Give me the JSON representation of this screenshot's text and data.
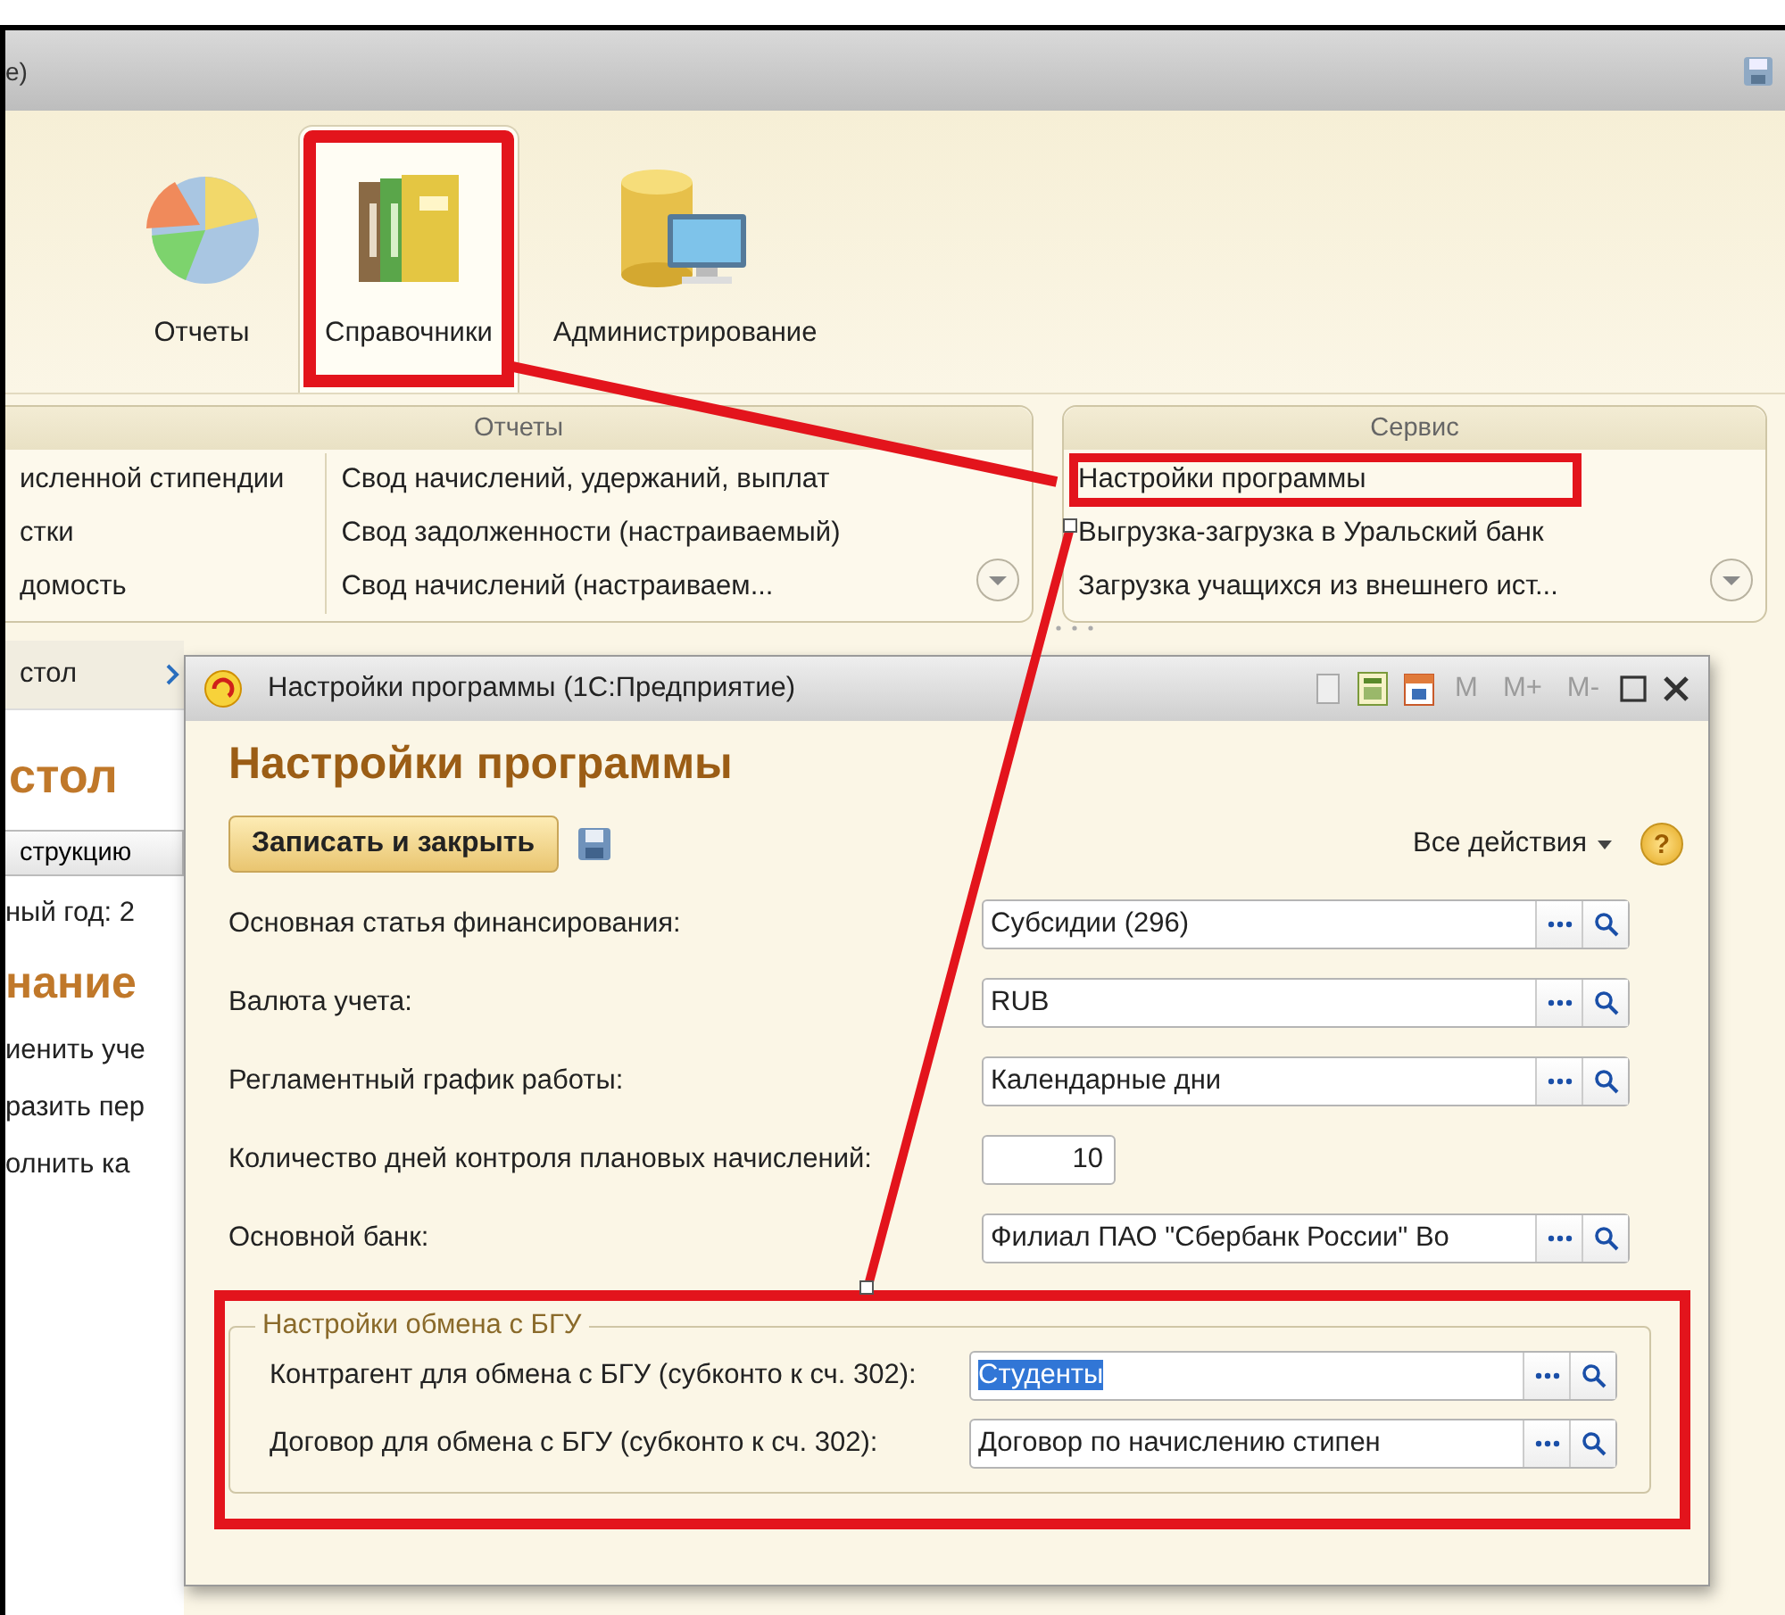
{
  "window": {
    "title": "е)"
  },
  "ribbon_tabs": [
    {
      "label": "Отчеты",
      "selected": false,
      "highlighted": false
    },
    {
      "label": "Справочники",
      "selected": true,
      "highlighted": true
    },
    {
      "label": "Администрирование",
      "selected": false,
      "highlighted": false
    }
  ],
  "panels": [
    {
      "title": "Отчеты",
      "columns": [
        [
          {
            "label": "исленной стипендии",
            "highlighted": false
          },
          {
            "label": "стки",
            "highlighted": false
          },
          {
            "label": "домость",
            "highlighted": false
          }
        ],
        [
          {
            "label": "Свод начислений, удержаний, выплат",
            "highlighted": false
          },
          {
            "label": "Свод задолженности (настраиваемый)",
            "highlighted": false
          },
          {
            "label": "Свод начислений (настраиваем...",
            "highlighted": false
          }
        ]
      ]
    },
    {
      "title": "Сервис",
      "columns": [
        [
          {
            "label": "Настройки программы",
            "highlighted": true
          },
          {
            "label": "Выгрузка-загрузка в Уральский банк",
            "highlighted": false
          },
          {
            "label": "Загрузка учащихся из внешнего ист...",
            "highlighted": false
          }
        ]
      ]
    }
  ],
  "sidebar": {
    "breadcrumb": "стол",
    "heading": "стол",
    "button": "струкцию",
    "year_label": "ный год: 2",
    "section_heading": "нание",
    "links": [
      "иенить уче",
      "разить пер",
      "олнить ка"
    ]
  },
  "dialog": {
    "title": "Настройки программы  (1С:Предприятие)",
    "memory_buttons": [
      "M",
      "M+",
      "M-"
    ],
    "heading": "Настройки программы",
    "save_close_button": "Записать и закрыть",
    "all_actions": "Все действия",
    "help": "?",
    "fields": [
      {
        "kind": "select",
        "label": "Основная статья финансирования:",
        "value": "Субсидии (296)"
      },
      {
        "kind": "select",
        "label": "Валюта учета:",
        "value": "RUB"
      },
      {
        "kind": "select",
        "label": "Регламентный график работы:",
        "value": "Календарные дни"
      },
      {
        "kind": "number",
        "label": "Количество дней контроля плановых начислений:",
        "value": "10"
      },
      {
        "kind": "select",
        "label": "Основной банк:",
        "value": "Филиал ПАО \"Сбербанк России\" Во"
      }
    ],
    "group": {
      "title": "Настройки обмена с БГУ",
      "highlighted": true,
      "fields": [
        {
          "kind": "select",
          "label": "Контрагент для обмена с БГУ (субконто к сч. 302):",
          "value": "Студенты",
          "value_selected": true
        },
        {
          "kind": "select",
          "label": "Договор для обмена с БГУ  (субконто к сч. 302):",
          "value": "Договор по начислению стипен",
          "value_selected": false
        }
      ]
    }
  }
}
